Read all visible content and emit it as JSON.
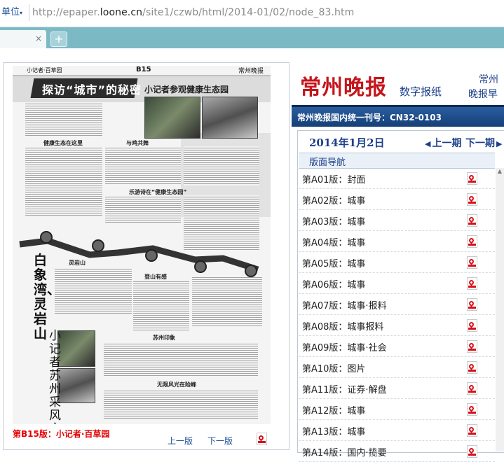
{
  "browser": {
    "address_prefix": "单位",
    "url_protocol": "http://epaper.",
    "url_host": "loone.cn",
    "url_path": "/site1/czwb/html/2014-01/02/node_83.htm",
    "new_tab_label": "+",
    "tab_close": "×"
  },
  "paper": {
    "header_left": "小记者·百草园",
    "header_center": "B15",
    "header_right": "常州晚报",
    "headline": "探访“城市”的秘密",
    "headline_sub": "小记者参观健康生态园",
    "subheads": [
      "健康生态在这里",
      "与鸡共舞",
      "乐游诗在“健康生态园”",
      "灵岩山",
      "登山有感",
      "苏州印象",
      "无限风光在险峰"
    ],
    "vertical_title": "白象湾、灵岩山",
    "vertical_sub": "小记者苏州采风之旅",
    "footer_label": "第B15版：小记者·百草园",
    "prev_page": "上一版",
    "next_page": "下一版"
  },
  "masthead": {
    "logo": "常州晚报",
    "subtitle": "数字报纸",
    "top_right_1": "常州",
    "top_right_2": "晚报早",
    "issn": "常州晚报国内统一刊号：CN32-0103"
  },
  "issue": {
    "date": "2014年1月2日",
    "prev_issue": "上一期",
    "next_issue": "下一期"
  },
  "nav": {
    "heading": "版面导航",
    "pages": [
      "第A01版：封面",
      "第A02版：城事",
      "第A03版：城事",
      "第A04版：城事",
      "第A05版：城事",
      "第A06版：城事",
      "第A07版：城事·报料",
      "第A08版：城事报料",
      "第A09版：城事·社会",
      "第A10版：图片",
      "第A11版：证券·解盘",
      "第A12版：城事",
      "第A13版：城事",
      "第A14版：国内·揽要"
    ]
  },
  "icons": {
    "pdf": "pdf-icon",
    "prev": "arrow-left-icon",
    "next": "arrow-right-icon"
  },
  "colors": {
    "accent_red": "#e60000",
    "link_blue": "#1b3f8a",
    "issn_bar": "#1f4f8c",
    "tab_strip": "#7bbac5"
  }
}
